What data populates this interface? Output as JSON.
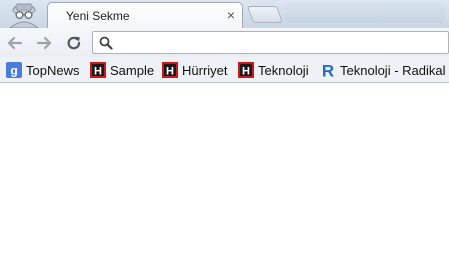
{
  "tab": {
    "title": "Yeni Sekme",
    "close_glyph": "×"
  },
  "omnibox": {
    "value": "",
    "placeholder": ""
  },
  "bookmarks": [
    {
      "label": "TopNews",
      "icon": "google-icon"
    },
    {
      "label": "Sample",
      "icon": "hurriyet-icon"
    },
    {
      "label": "Hürriyet",
      "icon": "hurriyet-icon"
    },
    {
      "label": "Teknoloji",
      "icon": "hurriyet-icon"
    },
    {
      "label": "Teknoloji - Radikal",
      "icon": "radikal-icon"
    }
  ],
  "colors": {
    "google_blue": "#4a7cdc",
    "hurriyet_red": "#d01818",
    "radikal_blue": "#1f6fc2"
  }
}
